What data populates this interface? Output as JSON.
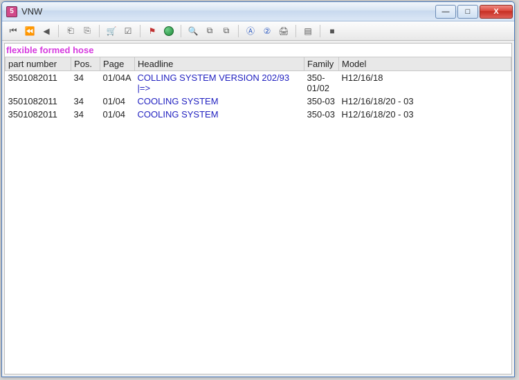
{
  "window": {
    "title": "VNW",
    "icon_letter": "5"
  },
  "subtitle": "flexible formed hose",
  "columns": {
    "part_number": "part number",
    "pos": "Pos.",
    "page": "Page",
    "headline": "Headline",
    "family": "Family",
    "model": "Model"
  },
  "rows": [
    {
      "part_number": "3501082011",
      "pos": "34",
      "page": "01/04A",
      "headline": "COLLING SYSTEM  VERSION 202/93 |=>",
      "family": "350-01/02",
      "model": "H12/16/18"
    },
    {
      "part_number": "3501082011",
      "pos": "34",
      "page": "01/04",
      "headline": "COOLING SYSTEM",
      "family": "350-03",
      "model": "H12/16/18/20 - 03"
    },
    {
      "part_number": "3501082011",
      "pos": "34",
      "page": "01/04",
      "headline": "COOLING SYSTEM",
      "family": "350-03",
      "model": "H12/16/18/20 - 03"
    }
  ],
  "winbuttons": {
    "min": "—",
    "max": "□",
    "close": "X"
  }
}
